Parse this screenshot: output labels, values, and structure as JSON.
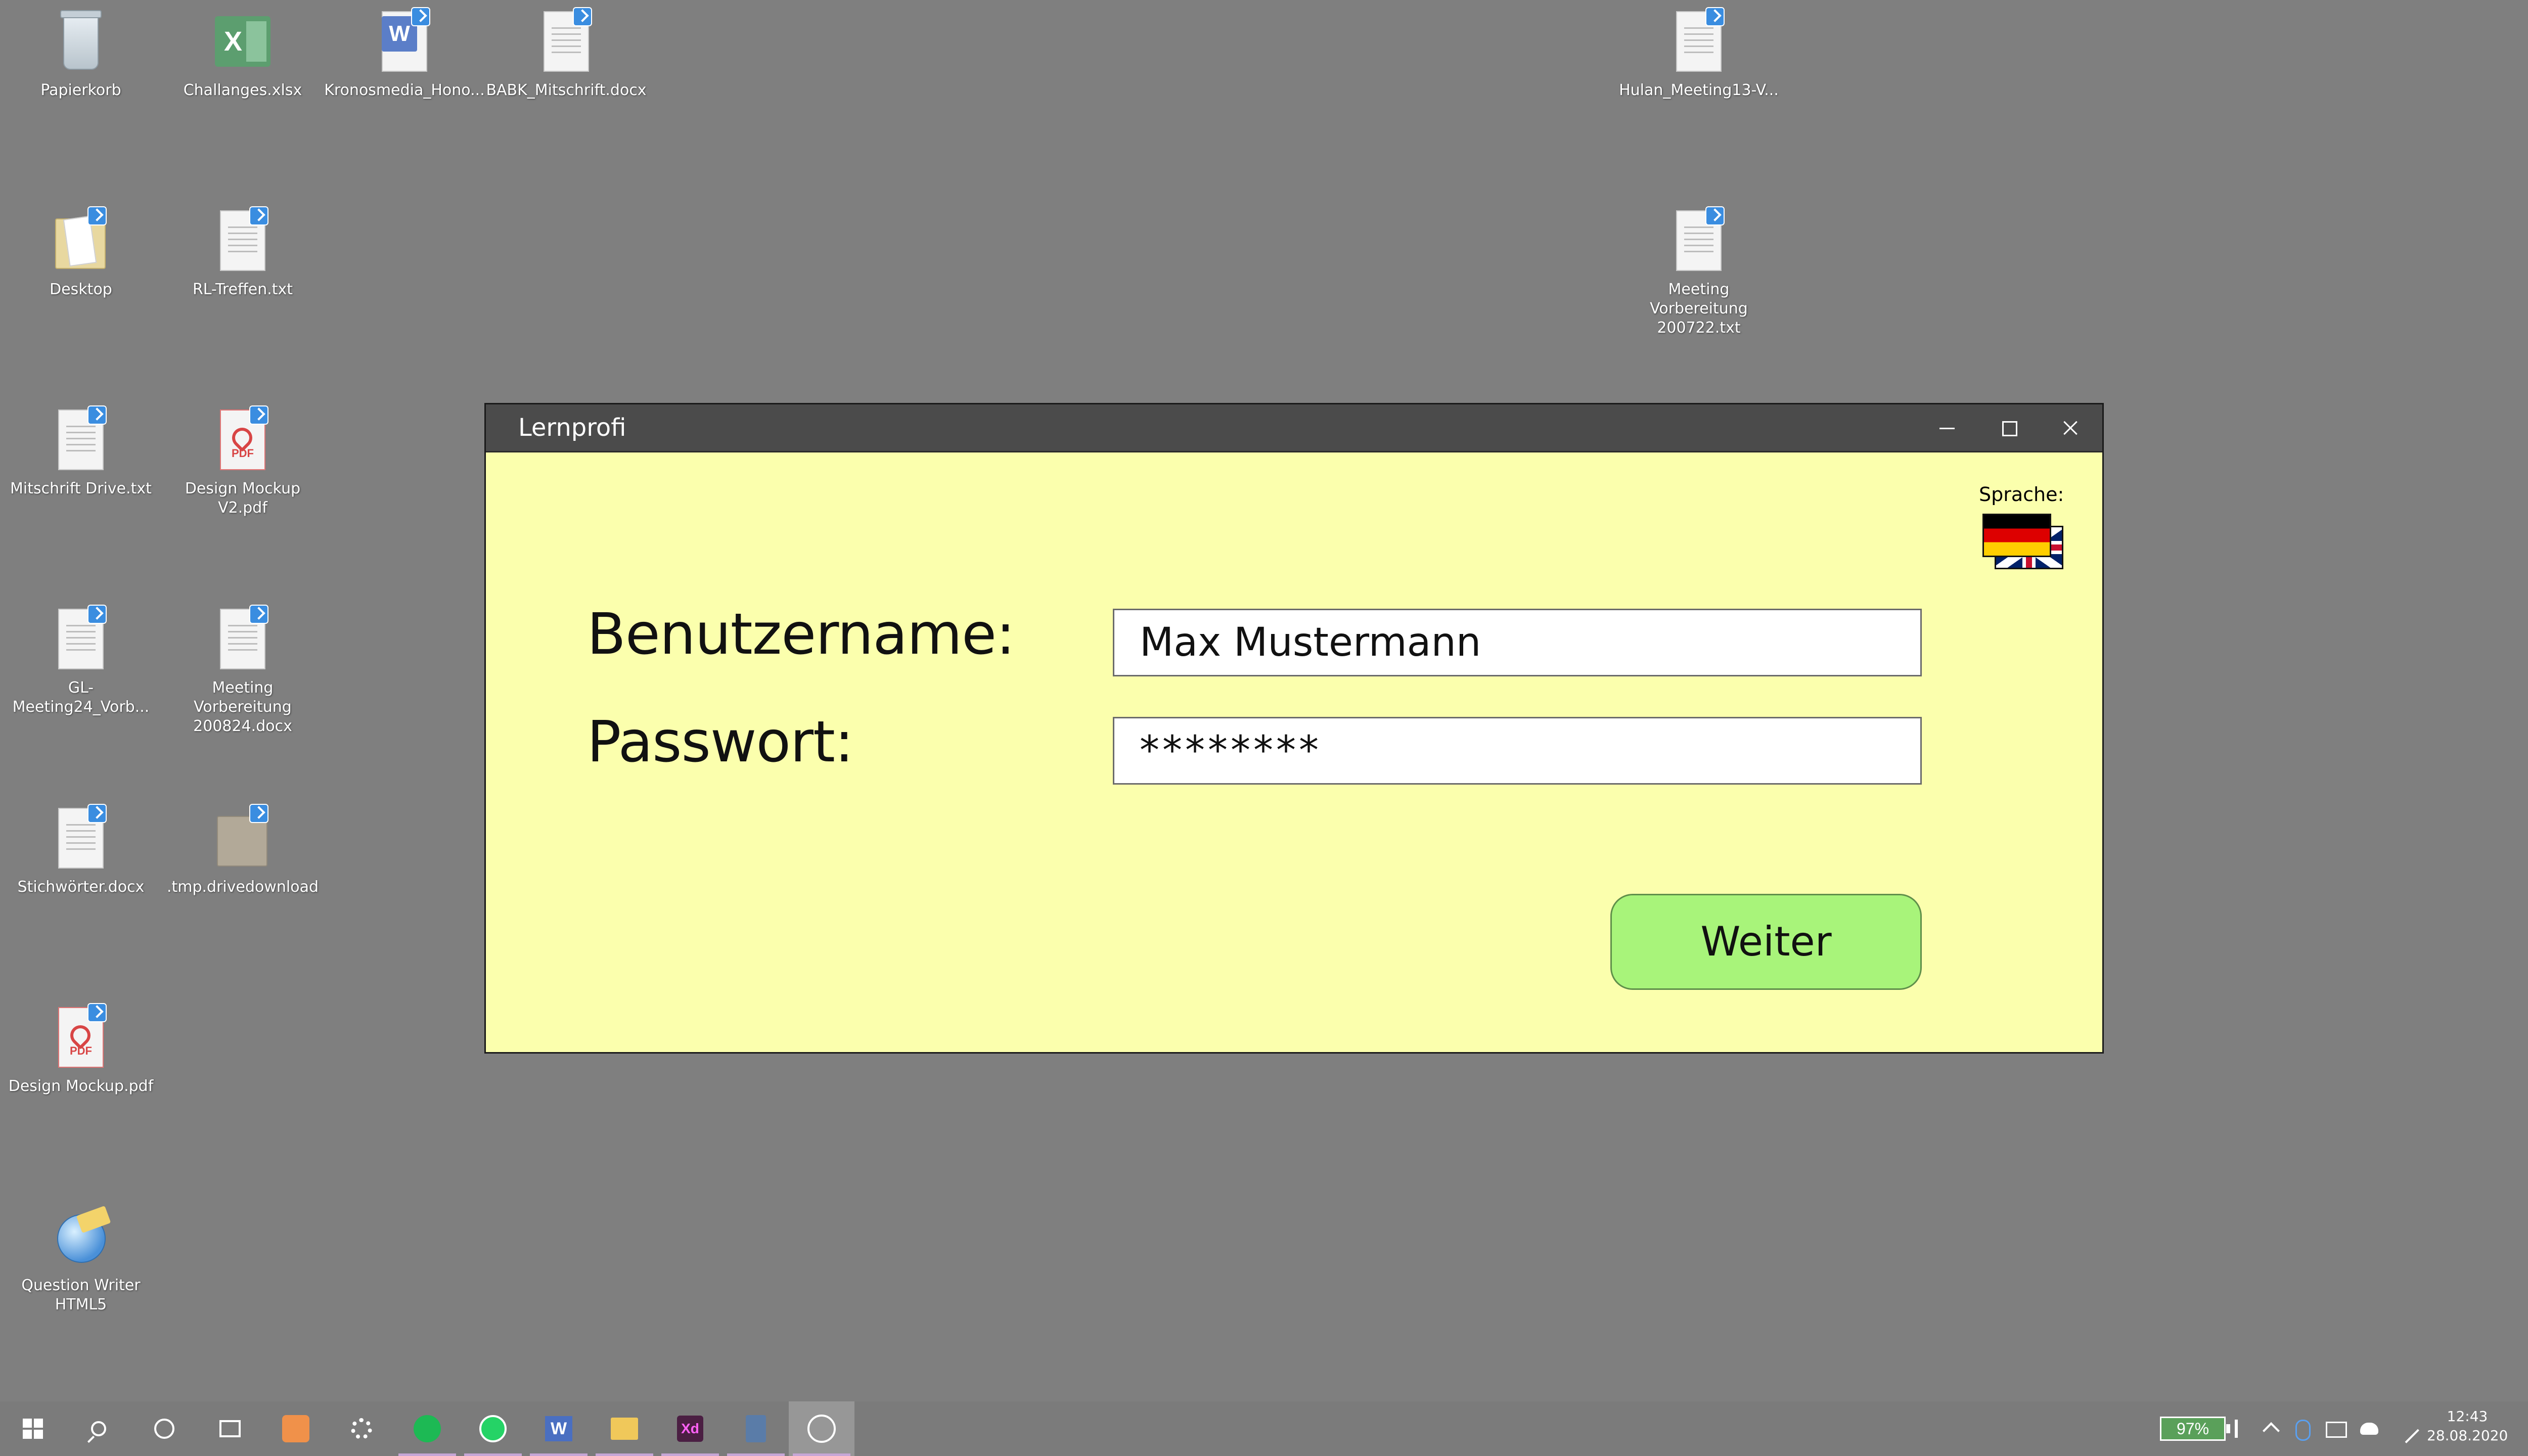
{
  "desktop": {
    "icons": [
      {
        "label": "Papierkorb"
      },
      {
        "label": "Challanges.xlsx"
      },
      {
        "label": "Kronosmedia_Hono..."
      },
      {
        "label": "BABK_Mitschrift.docx"
      },
      {
        "label": "Hulan_Meeting13-V..."
      },
      {
        "label": "Desktop"
      },
      {
        "label": "RL-Treffen.txt"
      },
      {
        "label": "Meeting Vorbereitung\n200722.txt"
      },
      {
        "label": "Mitschrift Drive.txt"
      },
      {
        "label": "Design Mockup\nV2.pdf"
      },
      {
        "label": "GL-Meeting24_Vorb..."
      },
      {
        "label": "Meeting Vorbereitung\n200824.docx"
      },
      {
        "label": "Stichwörter.docx"
      },
      {
        "label": ".tmp.drivedownload"
      },
      {
        "label": "Design Mockup.pdf"
      },
      {
        "label": "Question Writer\nHTML5"
      }
    ],
    "glyphs": {
      "xlsx": "X",
      "docx": "W",
      "pdf": "PDF"
    }
  },
  "window": {
    "title": "Lernprofi",
    "language_label": "Sprache:",
    "language_flags": [
      "german-flag",
      "uk-flag"
    ],
    "username_label": "Benutzername:",
    "username_value": "Max Mustermann",
    "password_label": "Passwort:",
    "password_value": "********",
    "continue_button": "Weiter",
    "background_color": "#fbffad",
    "button_color": "#a8f47a"
  },
  "taskbar": {
    "apps": [
      "start-icon",
      "search-icon",
      "cortana-icon",
      "task-view-icon",
      "xampp-icon",
      "settings-icon",
      "spotify-icon",
      "whatsapp-icon",
      "word-icon",
      "file-explorer-icon",
      "adobe-xd-icon",
      "calculator-icon",
      "photos-icon"
    ],
    "xd_glyph": "Xd",
    "word_glyph": "W",
    "battery": "97%",
    "time": "12:43",
    "date": "28.08.2020"
  }
}
